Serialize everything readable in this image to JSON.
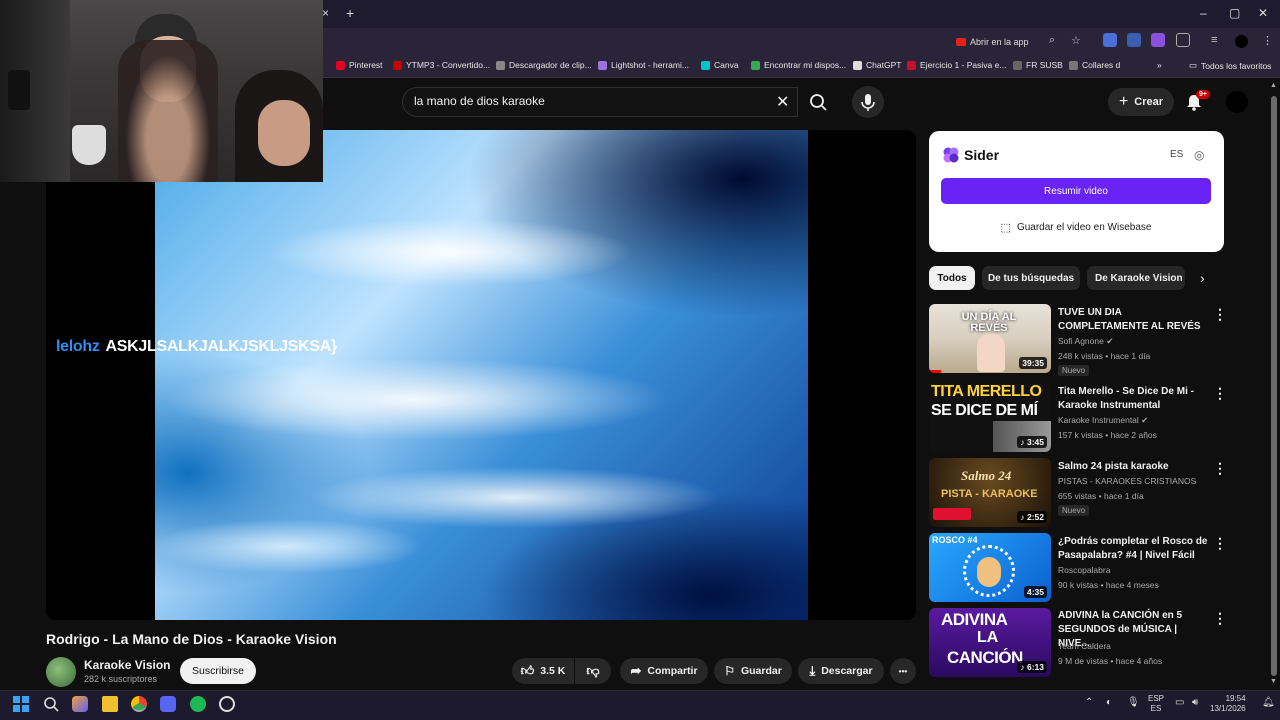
{
  "browser": {
    "tab_close": "×",
    "new_tab": "+",
    "open_in_app": "Abrir en la app",
    "bookmarks": [
      {
        "label": "Pinterest",
        "color": "#e60023"
      },
      {
        "label": "YTMP3 - Convertido...",
        "color": "#cc0000"
      },
      {
        "label": "Descargador de clip...",
        "color": "#888888"
      },
      {
        "label": "Lightshot - herrami...",
        "color": "#a070e0"
      },
      {
        "label": "Canva",
        "color": "#00c4cc"
      },
      {
        "label": "Encontrar mi dispos...",
        "color": "#34a853"
      },
      {
        "label": "ChatGPT",
        "color": "#dddddd"
      },
      {
        "label": "Ejercicio 1 - Pasiva e...",
        "color": "#c8102e"
      },
      {
        "label": "FR SUSB",
        "color": "#666666"
      },
      {
        "label": "Collares d",
        "color": "#777777"
      }
    ],
    "all_favorites": "Todos los favoritos"
  },
  "youtube": {
    "search_query": "la mano de dios karaoke",
    "create_label": "Crear",
    "notif_badge": "9+"
  },
  "player": {
    "lyrics_sung": "lelohz",
    "lyrics_next": "ASKJLSALKJALKJSKLJSKSA}"
  },
  "video": {
    "title": "Rodrigo - La Mano de Dios - Karaoke Vision",
    "channel": "Karaoke Vision",
    "subscribers": "282 k suscriptores",
    "subscribe": "Suscribirse",
    "likes": "3.5 K",
    "share": "Compartir",
    "save": "Guardar",
    "download": "Descargar",
    "more": "•••"
  },
  "sider": {
    "name": "Sider",
    "lang": "ES",
    "summarize": "Resumir video",
    "save_wisebase": "Guardar el video en Wisebase"
  },
  "chips": [
    "Todos",
    "De tus búsquedas",
    "De Karaoke Vision"
  ],
  "recommendations": [
    {
      "title": "TUVE UN DIA COMPLETAMENTE AL REVÉS",
      "channel": "Sofi Agnone",
      "meta": "248 k vistas • hace 1 día",
      "duration": "39:35",
      "badge": "Nuevo",
      "thumb_text": "UN DÍA AL REVÉS"
    },
    {
      "title": "Tita Merello - Se Dice De Mi - Karaoke Instrumental",
      "channel": "Karaoke Instrumental",
      "meta": "157 k vistas • hace 2 años",
      "duration": "3:45",
      "badge": "",
      "thumb_text": "TITA MERELLO",
      "thumb_text2": "SE DICE DE MÍ"
    },
    {
      "title": "Salmo 24 pista karaoke",
      "channel": "PISTAS - KARAOKES CRISTIANOS",
      "meta": "655 vistas • hace 1 día",
      "duration": "2:52",
      "badge": "Nuevo",
      "thumb_text": "Salmo 24",
      "thumb_text2": "PISTA - KARAOKE"
    },
    {
      "title": "¿Podrás completar el Rosco de Pasapalabra? #4 | Nivel Fácil",
      "channel": "Roscopalabra",
      "meta": "90 k vistas • hace 4 meses",
      "duration": "4:35",
      "badge": "",
      "thumb_text": "ROSCO #4"
    },
    {
      "title": "ADIVINA la CANCIÓN en 5 SEGUNDOS de MÚSICA | NIVE...",
      "channel": "Team Caldera",
      "meta": "9 M de vistas • hace 4 años",
      "duration": "6:13",
      "badge": "",
      "thumb_text": "ADIVINA",
      "thumb_text2": "LA",
      "thumb_text3": "CANCIÓN"
    }
  ],
  "taskbar": {
    "lang_line1": "ESP",
    "lang_line2": "ES",
    "time": "19:54",
    "date": "13/1/2026"
  }
}
